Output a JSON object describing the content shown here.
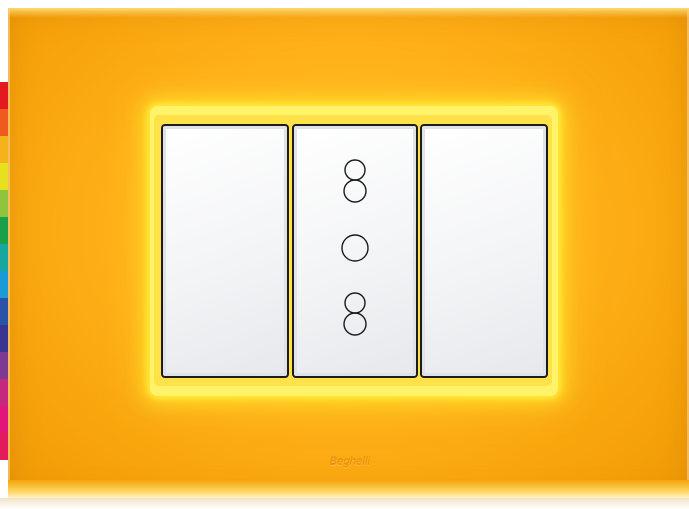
{
  "product": {
    "brand_logo": "Beghelli",
    "plate_color": "#ffb21a",
    "glow_color": "#ffe93a",
    "module_color": "#f3f4f6"
  },
  "color_swatches": [
    "#e3191f",
    "#ef5a1e",
    "#f6b21a",
    "#e6e01e",
    "#8fc43c",
    "#1ba04a",
    "#17a6a0",
    "#1a9ad6",
    "#2a52a6",
    "#3a3591",
    "#7d3a92",
    "#c4297f",
    "#e2157a",
    "#e31b5a"
  ],
  "modules": {
    "left": "blank-button",
    "center": "socket",
    "right": "blank-button"
  },
  "socket_icons": [
    "bipasso-socket-icon",
    "round-socket-icon",
    "bipasso-socket-icon"
  ]
}
